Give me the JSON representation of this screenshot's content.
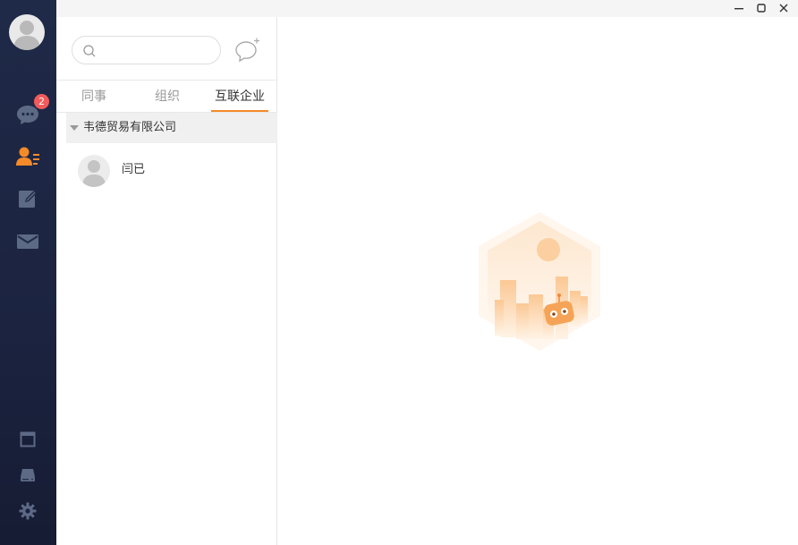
{
  "nav": {
    "unread_badge": "2",
    "icons": [
      "avatar",
      "chat-icon",
      "contacts-icon",
      "edit-icon",
      "mail-icon",
      "window-icon",
      "drive-icon",
      "settings-icon"
    ],
    "accent": "#f58a29"
  },
  "window": {
    "minimize": "–",
    "maximize": "▢",
    "close": "✕"
  },
  "contacts": {
    "search_placeholder": "",
    "tabs": [
      "同事",
      "组织",
      "互联企业"
    ],
    "active_tab": "互联企业",
    "group_name": "韦德贸易有限公司",
    "members": [
      {
        "name": "闫已"
      }
    ]
  }
}
